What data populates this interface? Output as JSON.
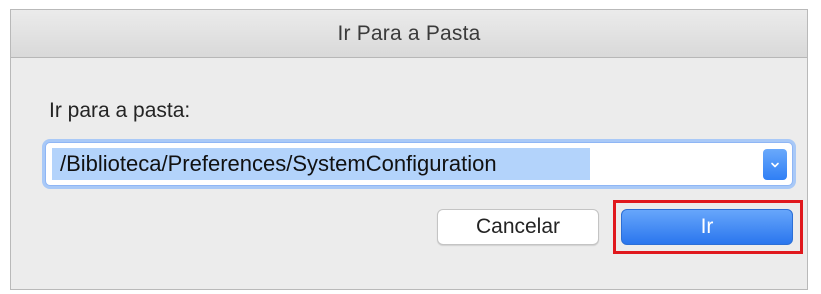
{
  "dialog": {
    "title": "Ir Para a Pasta",
    "prompt_label": "Ir para a pasta:",
    "path_value": "/Biblioteca/Preferences/SystemConfiguration",
    "path_selected": true,
    "dropdown_icon": "chevron-down-icon"
  },
  "buttons": {
    "cancel_label": "Cancelar",
    "go_label": "Ir"
  },
  "annotation": {
    "highlight_color": "#e0181d",
    "highlight_target": "go-button"
  },
  "colors": {
    "accent": "#2f7ff5",
    "selection": "#b3d3fb",
    "focus_ring": "#a9c9f7"
  }
}
